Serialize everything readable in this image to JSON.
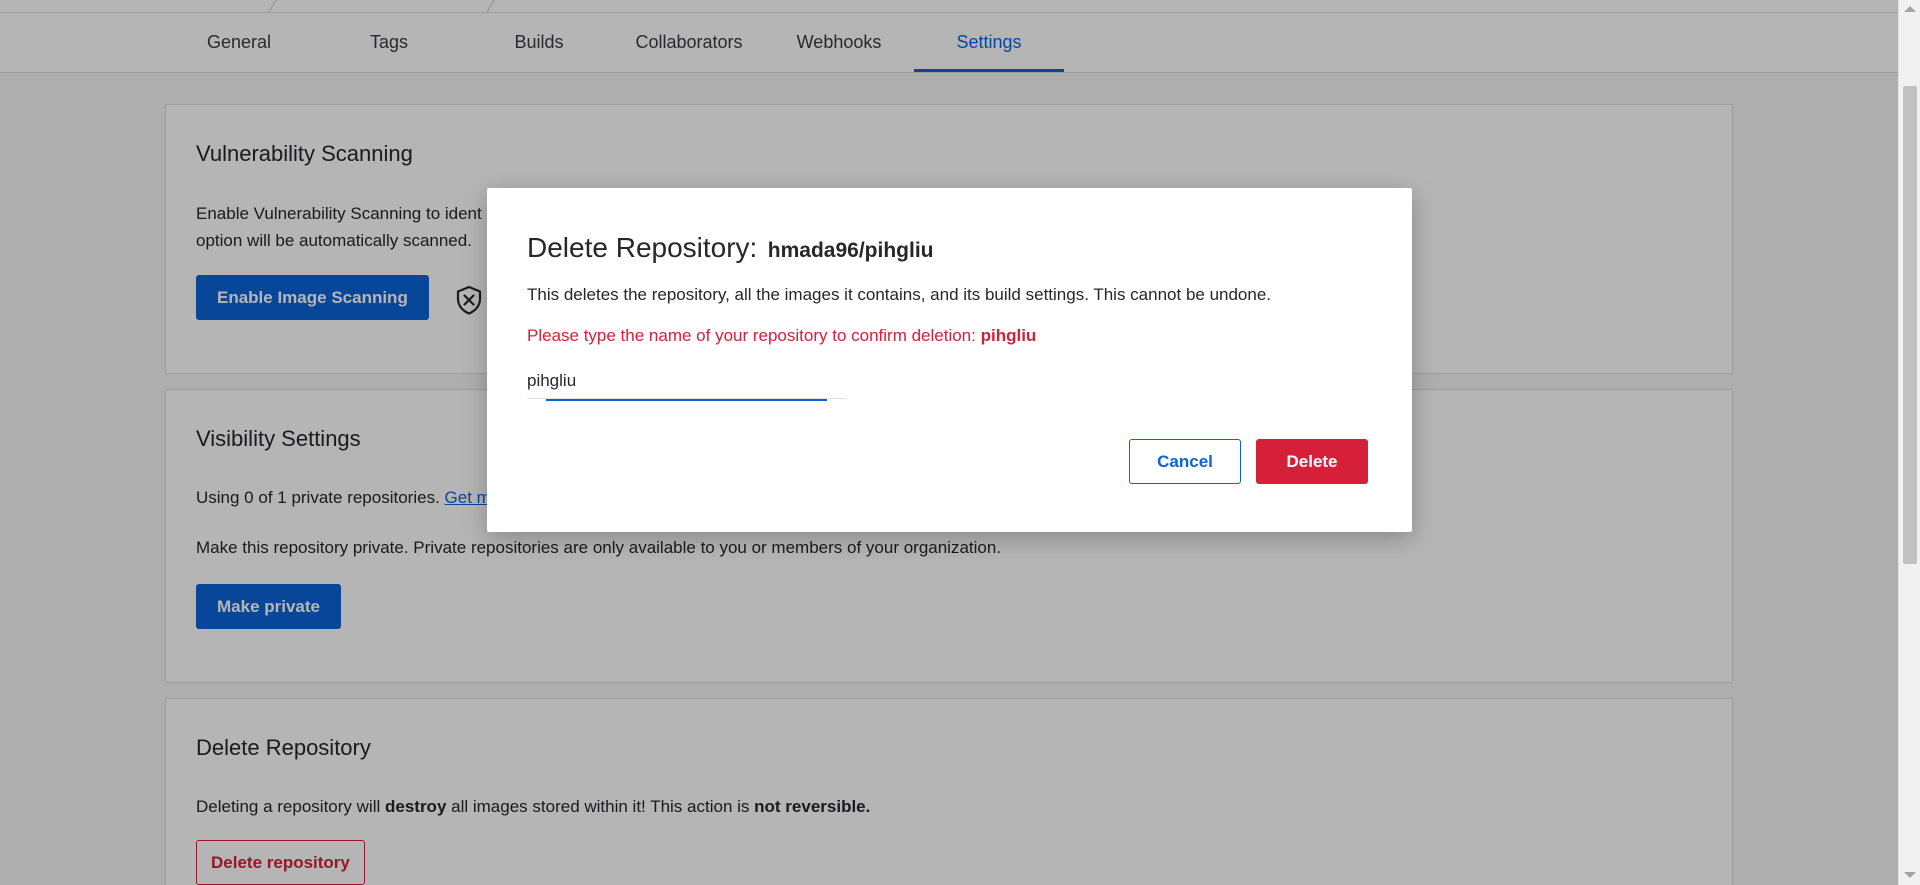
{
  "tabs": [
    {
      "label": "General"
    },
    {
      "label": "Tags"
    },
    {
      "label": "Builds"
    },
    {
      "label": "Collaborators"
    },
    {
      "label": "Webhooks"
    },
    {
      "label": "Settings",
      "active": true
    }
  ],
  "vulnerability": {
    "title": "Vulnerability Scanning",
    "text_line1": "Enable Vulnerability Scanning to ident",
    "text_line2": "option will be automatically scanned.",
    "button_label": "Enable Image Scanning",
    "status_icon": "shield-x-icon"
  },
  "visibility": {
    "title": "Visibility Settings",
    "usage_text": "Using 0 of 1 private repositories.",
    "usage_link": "Get m",
    "description": "Make this repository private. Private repositories are only available to you or members of your organization.",
    "button_label": "Make private"
  },
  "delete_section": {
    "title": "Delete Repository",
    "text_before": "Deleting a repository will",
    "text_bold1": "destroy",
    "text_middle": "all images stored within it! This action is",
    "text_bold2": "not reversible.",
    "button_label": "Delete repository"
  },
  "modal": {
    "title_label": "Delete Repository:",
    "repo_name": "hmada96/pihgliu",
    "description": "This deletes the repository, all the images it contains, and its build settings. This cannot be undone.",
    "confirm_prompt": "Please type the name of your repository to confirm deletion:",
    "confirm_name": "pihgliu",
    "input_value": "pihgliu",
    "cancel_label": "Cancel",
    "delete_label": "Delete"
  },
  "colors": {
    "primary": "#0b63d6",
    "danger": "#d6203a",
    "overlay": "rgba(0,0,0,0.29)"
  }
}
